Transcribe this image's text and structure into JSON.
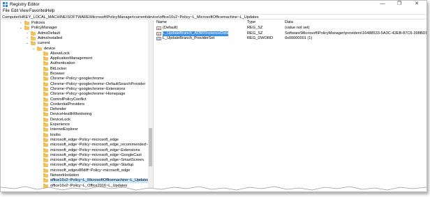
{
  "window": {
    "title": "Registry Editor",
    "controls": {
      "minimize": "—",
      "restore": "❐",
      "close": "✕"
    }
  },
  "menu": [
    "File",
    "Edit",
    "View",
    "Favorites",
    "Help"
  ],
  "address": "Computer\\HKEY_LOCAL_MACHINE\\SOFTWARE\\Microsoft\\PolicyManager\\current\\device\\office16v2~Policy~L_MicrosoftOfficemachine~L_Updates",
  "tree": [
    {
      "label": "Policies",
      "level": 0,
      "chevron": "›"
    },
    {
      "label": "PolicyManager",
      "level": 0,
      "chevron": "⌄"
    },
    {
      "label": "AdmxDefault",
      "level": 1,
      "chevron": "›"
    },
    {
      "label": "AdmxInstalled",
      "level": 1,
      "chevron": "›"
    },
    {
      "label": "current",
      "level": 1,
      "chevron": "⌄"
    },
    {
      "label": "device",
      "level": 2,
      "chevron": "⌄"
    },
    {
      "label": "AboveLock",
      "level": 3,
      "chevron": ""
    },
    {
      "label": "ApplicationManagement",
      "level": 3,
      "chevron": ""
    },
    {
      "label": "Authentication",
      "level": 3,
      "chevron": ""
    },
    {
      "label": "BitLocker",
      "level": 3,
      "chevron": ""
    },
    {
      "label": "Browser",
      "level": 3,
      "chevron": ""
    },
    {
      "label": "Chrome~Policy~googlechrome",
      "level": 3,
      "chevron": ""
    },
    {
      "label": "Chrome~Policy~googlechrome~DefaultSearchProvider",
      "level": 3,
      "chevron": ""
    },
    {
      "label": "Chrome~Policy~googlechrome~Extensions",
      "level": 3,
      "chevron": ""
    },
    {
      "label": "Chrome~Policy~googlechrome~Homepage",
      "level": 3,
      "chevron": ""
    },
    {
      "label": "ControlPolicyConflict",
      "level": 3,
      "chevron": ""
    },
    {
      "label": "CredentialProviders",
      "level": 3,
      "chevron": ""
    },
    {
      "label": "Defender",
      "level": 3,
      "chevron": ""
    },
    {
      "label": "DeviceHealthMonitoring",
      "level": 3,
      "chevron": ""
    },
    {
      "label": "DeviceLock",
      "level": 3,
      "chevron": ""
    },
    {
      "label": "Experience",
      "level": 3,
      "chevron": ""
    },
    {
      "label": "InternetExplorer",
      "level": 3,
      "chevron": ""
    },
    {
      "label": "knobs",
      "level": 3,
      "chevron": ""
    },
    {
      "label": "microsoft_edge~Policy~microsoft_edge",
      "level": 3,
      "chevron": ""
    },
    {
      "label": "microsoft_edge~Policy~microsoft_edge_recommended~Star",
      "level": 3,
      "chevron": ""
    },
    {
      "label": "microsoft_edge~Policy~microsoft_edge~Extensions",
      "level": 3,
      "chevron": ""
    },
    {
      "label": "microsoft_edge~Policy~microsoft_edge~GoogleCast",
      "level": 3,
      "chevron": ""
    },
    {
      "label": "microsoft_edge~Policy~microsoft_edge~SmartScreen",
      "level": 3,
      "chevron": ""
    },
    {
      "label": "microsoft_edge~Policy~microsoft_edge~Startup",
      "level": 3,
      "chevron": ""
    },
    {
      "label": "microsoft_edgev80diff~Policy~microsoft_edge",
      "level": 3,
      "chevron": ""
    },
    {
      "label": "NetworkIsolation",
      "level": 3,
      "chevron": ""
    },
    {
      "label": "office16v2~Policy~L_MicrosoftOfficemachine~L_Updates",
      "level": 3,
      "chevron": "",
      "selected": true
    },
    {
      "label": "office16v2~Policy~L_Office2016~L_Updates",
      "level": 3,
      "chevron": ""
    }
  ],
  "columns": {
    "name": "Name",
    "type": "Type",
    "data": "Data"
  },
  "values": [
    {
      "icon": "ab",
      "kind": "sz",
      "name": "(Default)",
      "type": "REG_SZ",
      "data": "(value not set)"
    },
    {
      "icon": "ab",
      "kind": "sz",
      "name": "L_UpdateBranch_ADMXInstanceData",
      "type": "REG_SZ",
      "data": "Software\\Microsoft\\PolicyManager\\providers\\16488533-5A3C-42EB-87C6-398BDD4E399F\\ule...",
      "selected": true
    },
    {
      "icon": "01",
      "kind": "dw",
      "name": "L_UpdateBranch_ProviderSet",
      "type": "REG_DWORD",
      "data": "0x00000001 (1)"
    }
  ]
}
